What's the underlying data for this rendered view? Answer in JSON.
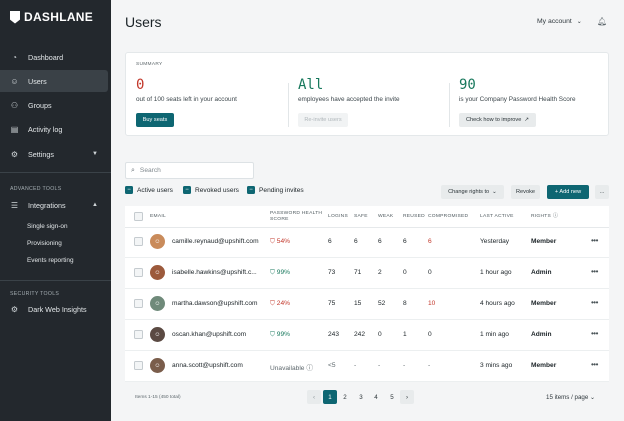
{
  "brand": {
    "name": "DASHLANE"
  },
  "sidebar": {
    "items": [
      {
        "label": "Dashboard",
        "icon": "dashboard-icon"
      },
      {
        "label": "Users",
        "icon": "user-icon"
      },
      {
        "label": "Groups",
        "icon": "group-icon"
      },
      {
        "label": "Activity log",
        "icon": "log-icon"
      },
      {
        "label": "Settings",
        "icon": "gear-icon"
      }
    ],
    "advanced_label": "ADVANCED TOOLS",
    "integrations": {
      "label": "Integrations",
      "icon": "sliders-icon"
    },
    "sub_items": [
      "Single sign-on",
      "Provisioning",
      "Events reporting"
    ],
    "security_label": "SECURITY TOOLS",
    "dark_web": {
      "label": "Dark Web Insights",
      "icon": "gear-icon"
    }
  },
  "header": {
    "title": "Users",
    "account": "My account"
  },
  "summary": {
    "label": "SUMMARY",
    "seats": {
      "value": "0",
      "text": "out of 100 seats left in your account",
      "button": "Buy seats"
    },
    "invite": {
      "value": "All",
      "text": "employees have accepted the invite",
      "button": "Re-invite users"
    },
    "health": {
      "value": "90",
      "text": "is your Company Password Health Score",
      "button": "Check how to improve"
    }
  },
  "search": {
    "placeholder": "Search"
  },
  "filters": [
    "Active users",
    "Revoked users",
    "Pending invites"
  ],
  "actions": {
    "change_rights": "Change rights to",
    "revoke": "Revoke",
    "add_new": "+ Add new",
    "more": "..."
  },
  "table": {
    "headers": {
      "email": "EMAIL",
      "health_1": "PASSWORD HEALTH",
      "health_2": "SCORE",
      "logins": "LOGINS",
      "safe": "SAFE",
      "weak": "WEAK",
      "reused": "REUSED",
      "compromised": "COMPROMISED",
      "last_active": "LAST ACTIVE",
      "rights": "RIGHTS"
    },
    "rows": [
      {
        "email": "camille.reynaud@upshift.com",
        "health": "54%",
        "logins": "6",
        "safe": "6",
        "weak": "6",
        "reused": "6",
        "compromised": "6",
        "last_active": "Yesterday",
        "rights": "Member"
      },
      {
        "email": "isabelle.hawkins@upshift.c...",
        "health": "99%",
        "logins": "73",
        "safe": "71",
        "weak": "2",
        "reused": "0",
        "compromised": "0",
        "last_active": "1 hour ago",
        "rights": "Admin"
      },
      {
        "email": "martha.dawson@upshift.com",
        "health": "24%",
        "logins": "75",
        "safe": "15",
        "weak": "52",
        "reused": "8",
        "compromised": "10",
        "last_active": "4 hours ago",
        "rights": "Member"
      },
      {
        "email": "oscan.khan@upshift.com",
        "health": "99%",
        "logins": "243",
        "safe": "242",
        "weak": "0",
        "reused": "1",
        "compromised": "0",
        "last_active": "1 min ago",
        "rights": "Admin"
      },
      {
        "email": "anna.scott@upshift.com",
        "health": "Unavailable",
        "logins": "<5",
        "safe": "-",
        "weak": "-",
        "reused": "-",
        "compromised": "-",
        "last_active": "3 mins ago",
        "rights": "Member"
      }
    ]
  },
  "footer": {
    "count": "Items 1-15 (450 total)",
    "pages": [
      "1",
      "2",
      "3",
      "4",
      "5"
    ],
    "per_page": "15 items / page"
  },
  "colors": {
    "accent": "#0e6672",
    "sidebar": "#23282d",
    "danger": "#c2372a",
    "safe": "#17785c"
  }
}
